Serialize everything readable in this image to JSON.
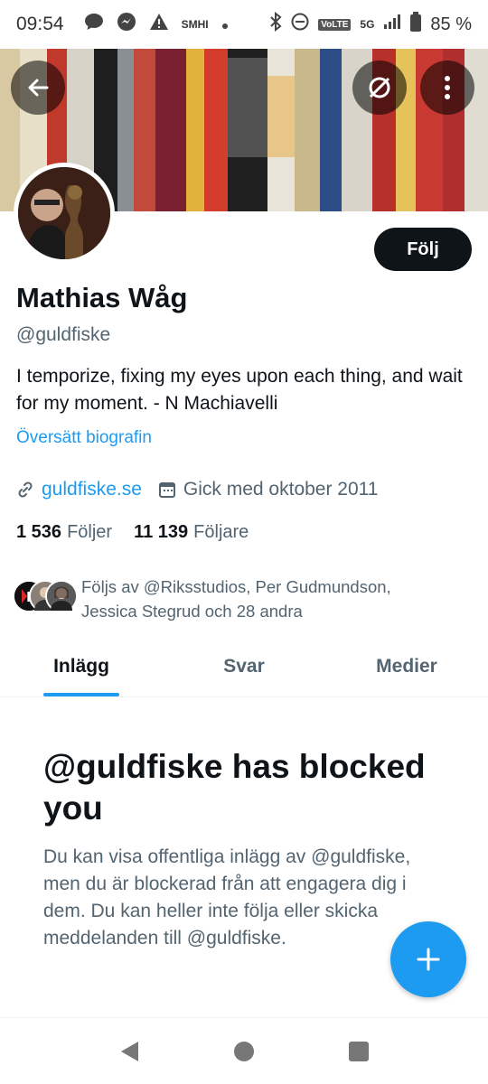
{
  "statusbar": {
    "time": "09:54",
    "smhi": "SMHI",
    "volte": "VoLTE",
    "network": "5G",
    "battery": "85 %"
  },
  "profile": {
    "follow_label": "Följ",
    "name": "Mathias Wåg",
    "handle": "@guldfiske",
    "bio": "I temporize, fixing my eyes upon each thing, and wait for my moment.  - N Machiavelli",
    "translate_label": "Översätt biografin",
    "website": "guldfiske.se",
    "joined": "Gick med oktober 2011",
    "following_count": "1 536",
    "following_label": "Följer",
    "followers_count": "11 139",
    "followers_label": "Följare",
    "followed_by": "Följs av @Riksstudios, Per Gudmundson, Jessica Stegrud och 28 andra"
  },
  "tabs": [
    {
      "label": "Inlägg"
    },
    {
      "label": "Svar"
    },
    {
      "label": "Medier"
    }
  ],
  "blocked": {
    "title": "@guldfiske has blocked you",
    "text": "Du kan visa offentliga inlägg av @guldfiske, men du är blockerad från att engagera dig i dem. Du kan heller inte följa eller skicka meddelanden till @guldfiske."
  },
  "colors": {
    "accent": "#1d9bf0",
    "text_primary": "#0f1419",
    "text_secondary": "#536471"
  },
  "icons": [
    "back-arrow-icon",
    "sync-off-icon",
    "more-vertical-icon",
    "link-icon",
    "calendar-icon",
    "plus-icon"
  ]
}
